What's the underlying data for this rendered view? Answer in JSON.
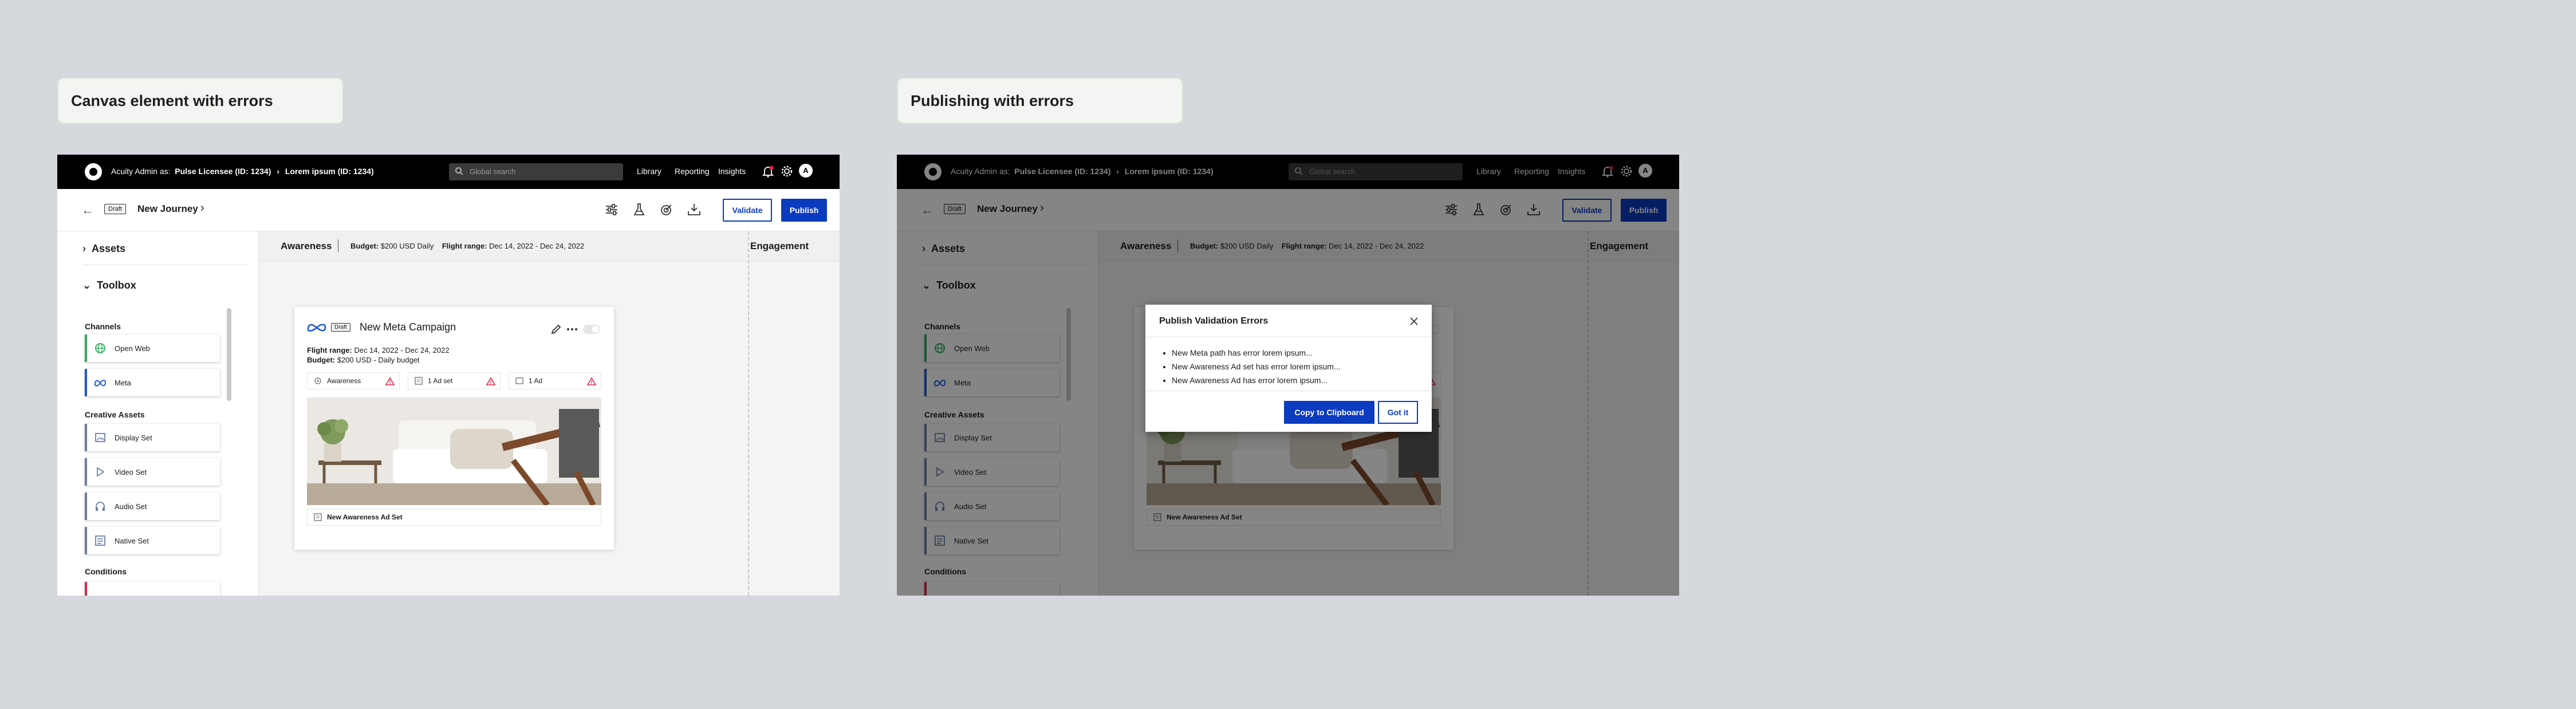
{
  "screens": [
    {
      "caption": "Canvas element with errors",
      "topbar": {
        "admin_prefix": "Acuity Admin as:",
        "license": "Pulse Licensee (ID: 1234)",
        "account": "Lorem ipsum (ID: 1234)",
        "search_placeholder": "Global search",
        "nav": [
          "Library",
          "Reporting",
          "Insights"
        ],
        "avatar_initial": "A"
      },
      "journey": {
        "tag": "Draft",
        "title": "New Journey",
        "validate_label": "Validate",
        "publish_label": "Publish"
      },
      "sidebar": {
        "assets_label": "Assets",
        "toolbox_label": "Toolbox",
        "categories": {
          "channels": "Channels",
          "creative": "Creative Assets",
          "conditions": "Conditions"
        },
        "channels": [
          {
            "label": "Open Web",
            "icon": "globe-icon",
            "color": "#2faf5b"
          },
          {
            "label": "Meta",
            "icon": "meta-icon",
            "color": "#1c59d9"
          }
        ],
        "creative": [
          {
            "label": "Display Set",
            "icon": "image-icon",
            "color": "#6b7fa8"
          },
          {
            "label": "Video Set",
            "icon": "play-icon",
            "color": "#6b7fa8"
          },
          {
            "label": "Audio Set",
            "icon": "headphones-icon",
            "color": "#6b7fa8"
          },
          {
            "label": "Native Set",
            "icon": "native-icon",
            "color": "#6b7fa8"
          }
        ]
      },
      "canvas": {
        "column": "Awareness",
        "budget_label": "Budget:",
        "budget_value": "$200 USD Daily",
        "flight_label": "Flight range:",
        "flight_value": "Dec 14, 2022 - Dec 24, 2022",
        "next_column": "Engagement"
      },
      "card": {
        "tag": "Draft",
        "title": "New Meta Campaign",
        "flight_label": "Flight range:",
        "flight_value": "Dec 14, 2022 - Dec 24, 2022",
        "budget_label": "Budget:",
        "budget_value": "$200 USD - Daily budget",
        "chips": [
          "Awareness",
          "1 Ad set",
          "1 Ad"
        ],
        "adset_label": "New Awareness Ad Set"
      },
      "error_color": "#e0284a",
      "accent_color": "#0b3bbf"
    },
    {
      "caption": "Publishing with errors",
      "modal": {
        "title": "Publish Validation Errors",
        "errors": [
          "New Meta path has error lorem ipsum...",
          "New Awareness Ad set has error lorem ipsum...",
          "New Awareness Ad has error lorem ipsum..."
        ],
        "copy_label": "Copy to Clipboard",
        "ok_label": "Got it"
      }
    }
  ]
}
